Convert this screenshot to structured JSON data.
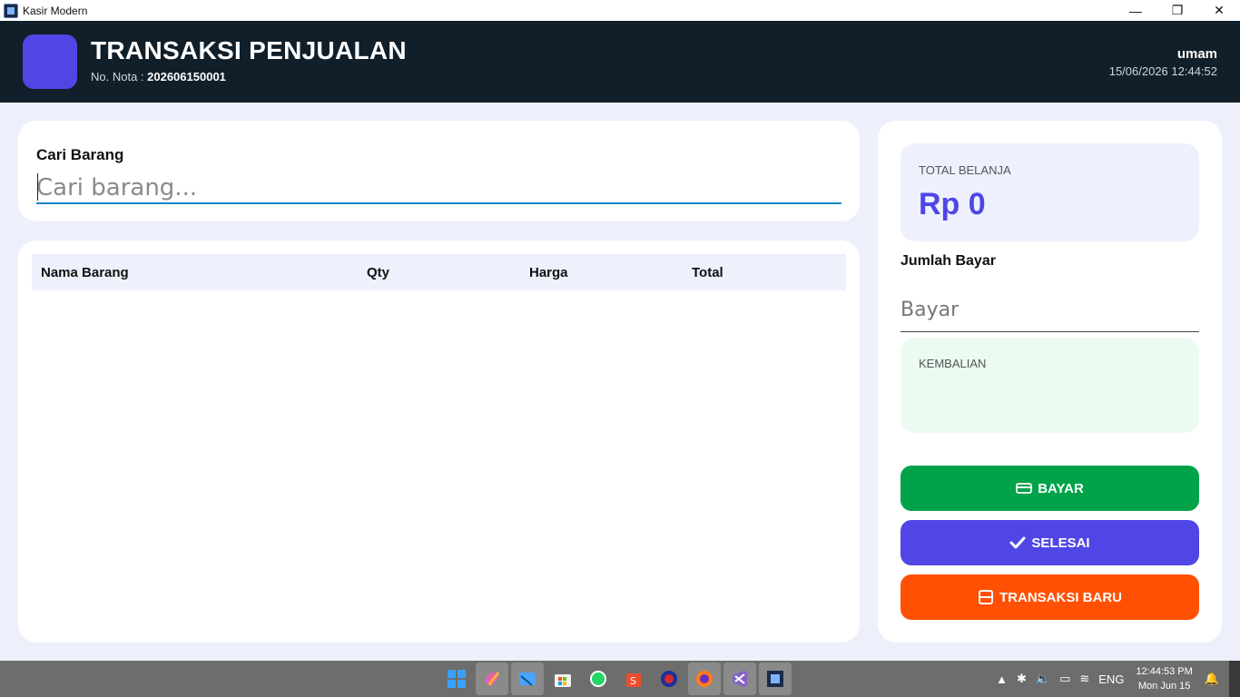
{
  "window": {
    "title": "Kasir Modern",
    "controls": {
      "minimize": "—",
      "restore": "❐",
      "close": "✕"
    }
  },
  "header": {
    "title": "TRANSAKSI PENJUALAN",
    "nota_label": "No. Nota : ",
    "nota_value": "202606150001",
    "user": "umam",
    "datetime": "15/06/2026 12:44:52",
    "logo_color": "#4f46e5"
  },
  "search": {
    "label": "Cari Barang",
    "placeholder": "Cari barang..."
  },
  "table": {
    "columns": [
      "Nama Barang",
      "Qty",
      "Harga",
      "Total"
    ],
    "rows": []
  },
  "summary": {
    "total_label": "TOTAL BELANJA",
    "total_value": "Rp 0",
    "bayar_label": "Jumlah Bayar",
    "bayar_placeholder": "Bayar",
    "kembalian_label": "KEMBALIAN"
  },
  "buttons": {
    "bayar": {
      "label": "BAYAR",
      "icon": "card-icon",
      "color": "#00a34a"
    },
    "selesai": {
      "label": "SELESAI",
      "icon": "check-icon",
      "color": "#4f46e5"
    },
    "baru": {
      "label": "TRANSAKSI BARU",
      "icon": "receipt-icon",
      "color": "#ff5004"
    }
  },
  "taskbar": {
    "apps": [
      "windows-start-icon",
      "copilot-icon",
      "file-explorer-icon",
      "microsoft-store-icon",
      "whatsapp-icon",
      "shopee-icon",
      "globe-app-icon",
      "firefox-icon",
      "visual-studio-icon",
      "kasir-modern-icon"
    ],
    "language": "ENG",
    "time": "12:44:53 PM",
    "date": "Mon Jun 15"
  }
}
